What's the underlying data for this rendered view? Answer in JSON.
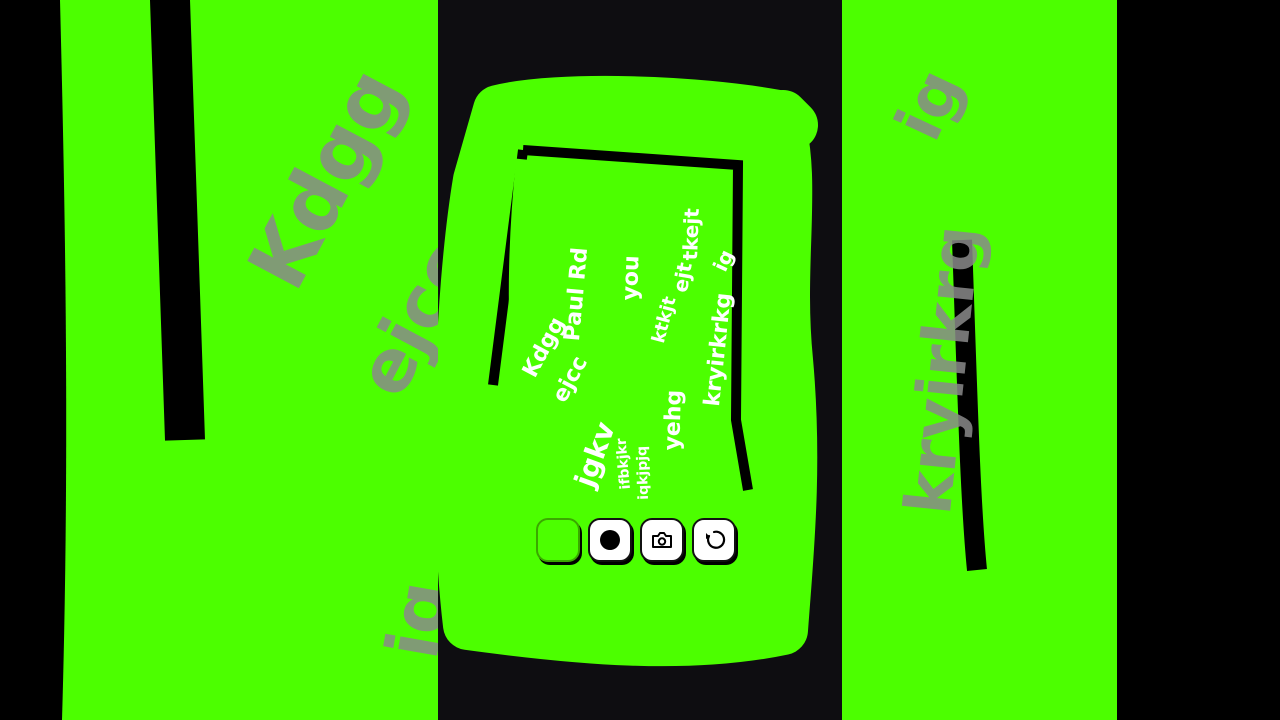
{
  "colors": {
    "brush": "#4cff00",
    "background": "#0e0d11",
    "ghost_text": "#8a8a8a",
    "toolbar_button": "#ffffff"
  },
  "doodle": {
    "lines": [
      "Kdgg",
      "Paul Rd",
      "ejcc",
      "jgkv",
      "you",
      "yehg",
      "kryirkrkg",
      "ig",
      "ejt",
      "tkejt",
      "iqkjpjq",
      "ifbkjkr",
      "ktkjt"
    ]
  },
  "background_text": {
    "left": [
      "Kdgg",
      "ejcc",
      "iq"
    ],
    "right": [
      "kryirkrg",
      "ig"
    ]
  },
  "toolbar": {
    "swatch_color": "#4cff00",
    "buttons": [
      {
        "icon": "color-swatch-icon"
      },
      {
        "icon": "brush-dot-icon"
      },
      {
        "icon": "camera-icon"
      },
      {
        "icon": "undo-icon"
      }
    ]
  }
}
